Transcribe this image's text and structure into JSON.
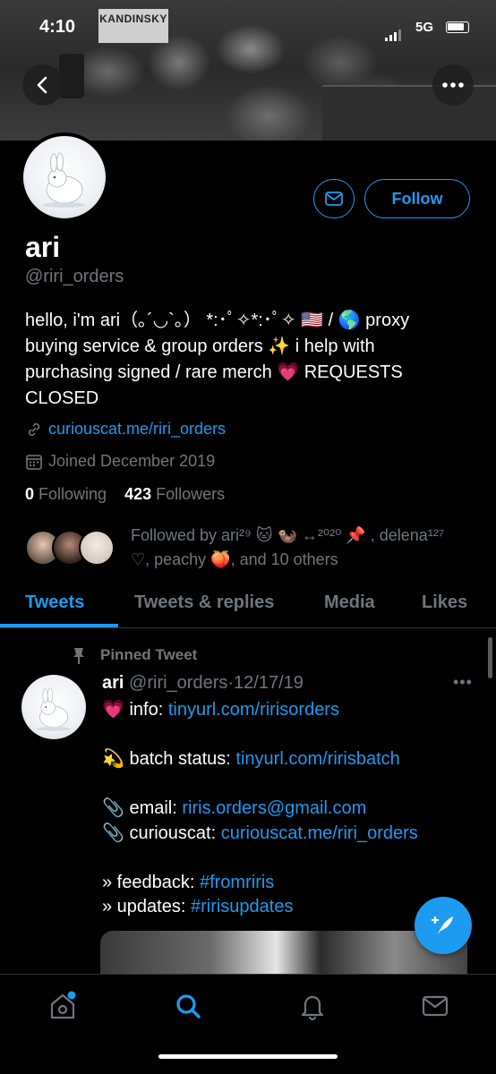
{
  "status_bar": {
    "time": "4:10",
    "network": "5G"
  },
  "banner": {
    "sign_title": "KANDINSKY"
  },
  "profile": {
    "name": "ari",
    "handle": "@riri_orders",
    "bio_lines": [
      "hello, i'm ari（｡´◡`｡） *:･ﾟ✧*:･ﾟ✧ 🇺🇸 / 🌎 proxy",
      "buying service & group orders ✨ i help with",
      "purchasing signed / rare merch 💗 REQUESTS",
      "CLOSED"
    ],
    "link": "curiouscat.me/riri_orders",
    "joined": "Joined December 2019",
    "following_count": "0",
    "following_label": "Following",
    "followers_count": "423",
    "followers_label": "Followers",
    "followed_by_line1": "Followed by ari²⁹ 🐱 🦦 ↔²⁰²⁰ 📌 , delena¹²⁷",
    "followed_by_line2": "♡, peachy 🍑, and 10 others",
    "follow_label": "Follow"
  },
  "tabs": [
    {
      "label": "Tweets"
    },
    {
      "label": "Tweets & replies"
    },
    {
      "label": "Media"
    },
    {
      "label": "Likes"
    }
  ],
  "tweet": {
    "pinned_label": "Pinned Tweet",
    "author": "ari",
    "handle": "@riri_orders",
    "date": "12/17/19",
    "info_label": "💗 info: ",
    "info_link": "tinyurl.com/ririsorders",
    "batch_label": "💫 batch status: ",
    "batch_link": "tinyurl.com/ririsbatch",
    "email_label": "📎 email: ",
    "email_link": "riris.orders@gmail.com",
    "cc_label": "📎 curiouscat: ",
    "cc_link": "curiouscat.me/riri_orders",
    "feedback_label": "» feedback: ",
    "feedback_link": "#fromriris",
    "updates_label": "» updates: ",
    "updates_link": "#ririsupdates"
  },
  "colors": {
    "accent": "#1d9bf0",
    "muted": "#6e767d",
    "background": "#000000"
  },
  "icons": [
    "back-arrow-icon",
    "more-icon",
    "mail-icon",
    "link-icon",
    "calendar-icon",
    "pin-icon",
    "compose-icon",
    "home-icon",
    "search-icon",
    "bell-icon",
    "inbox-icon"
  ]
}
